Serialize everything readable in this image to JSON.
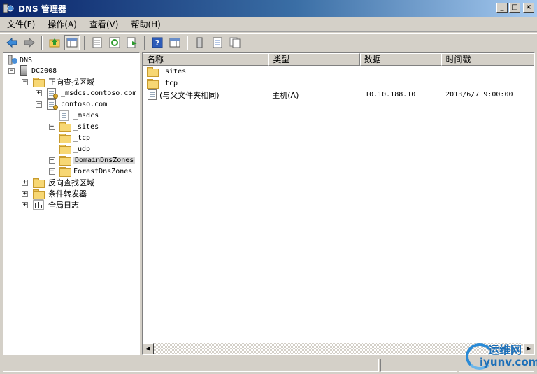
{
  "window": {
    "title": "DNS 管理器"
  },
  "menu": [
    "文件(F)",
    "操作(A)",
    "查看(V)",
    "帮助(H)"
  ],
  "tree": {
    "root": "DNS",
    "server": "DC2008",
    "forward_zone": "正向查找区域",
    "msdcs_zone": "_msdcs.contoso.com",
    "contoso_zone": "contoso.com",
    "children": [
      "_msdcs",
      "_sites",
      "_tcp",
      "_udp",
      "DomainDnsZones",
      "ForestDnsZones"
    ],
    "reverse_zone": "反向查找区域",
    "conditional_forwarders": "条件转发器",
    "global_logs": "全局日志"
  },
  "list": {
    "columns": [
      "名称",
      "类型",
      "数据",
      "时间戳"
    ],
    "rows": [
      {
        "name": "_sites",
        "type": "",
        "data": "",
        "timestamp": ""
      },
      {
        "name": "_tcp",
        "type": "",
        "data": "",
        "timestamp": ""
      },
      {
        "name": "(与父文件夹相同)",
        "type": "主机(A)",
        "data": "10.10.188.10",
        "timestamp": "2013/6/7 9:00:00"
      }
    ]
  },
  "watermark": {
    "top": "运维网",
    "bottom": "iyunv.com"
  }
}
